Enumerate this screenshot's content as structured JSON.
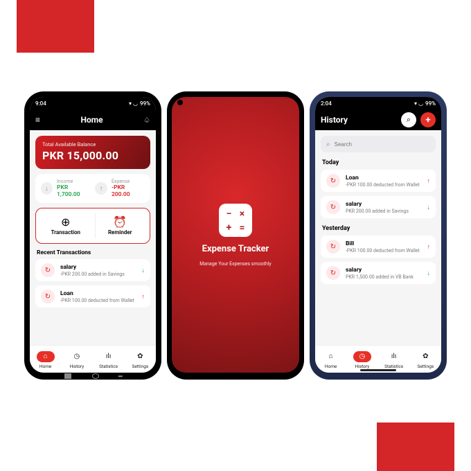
{
  "accent_color": "#d42528",
  "left": {
    "status": {
      "time": "9:04",
      "battery": "99%"
    },
    "header": {
      "title": "Home"
    },
    "balance": {
      "label": "Total Available Balance",
      "amount": "PKR 15,000.00"
    },
    "income": {
      "label": "Income",
      "value": "PKR 1,700.00"
    },
    "expense": {
      "label": "Expense",
      "value": "-PKR 200.00"
    },
    "actions": {
      "transaction": "Transaction",
      "reminder": "Reminder"
    },
    "recent_title": "Recent Transactions",
    "tx": [
      {
        "title": "salary",
        "sub": "-PKR 200.00 added in Savings",
        "dir": "down"
      },
      {
        "title": "Loan",
        "sub": "-PKR 100.00 deducted from Wallet",
        "dir": "up"
      }
    ],
    "nav": {
      "home": "Home",
      "history": "History",
      "stats": "Statistics",
      "settings": "Settings"
    }
  },
  "center": {
    "title": "Expense Tracker",
    "sub": "Manage Your Expenses smoothly"
  },
  "right": {
    "status": {
      "time": "2:04",
      "battery": "99%"
    },
    "header": {
      "title": "History"
    },
    "search": {
      "placeholder": "Search"
    },
    "groups": {
      "today": {
        "title": "Today",
        "tx": [
          {
            "title": "Loan",
            "sub": "-PKR 100.00 deducted from Wallet",
            "dir": "up"
          },
          {
            "title": "salary",
            "sub": "PKR 200.00 added in Savings",
            "dir": "down"
          }
        ]
      },
      "yesterday": {
        "title": "Yesterday",
        "tx": [
          {
            "title": "Bill",
            "sub": "-PKR 100.00 deducted from Wallet",
            "dir": "up"
          },
          {
            "title": "salary",
            "sub": "PKR 1,500.00 added in VB Bank",
            "dir": "down"
          }
        ]
      }
    },
    "nav": {
      "home": "Home",
      "history": "History",
      "stats": "Statistics",
      "settings": "Settings"
    }
  }
}
